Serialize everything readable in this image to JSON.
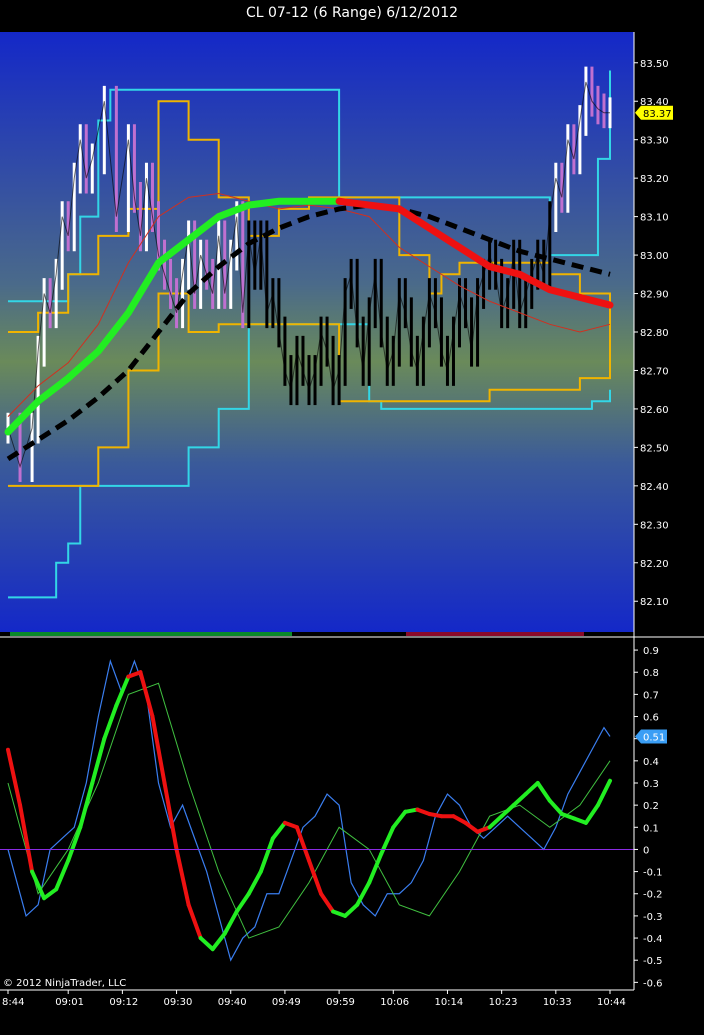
{
  "window": {
    "title": "CL 07-12 (6 Range)  6/12/2012",
    "copyright": "© 2012 NinjaTrader, LLC"
  },
  "colors": {
    "background": "#000000",
    "price_panel_top": "#1428c8",
    "price_panel_mid": "#5a7a5a",
    "price_panel_bottom": "#1428c8",
    "up_bars": "#ffffff",
    "down_bars": "#000000",
    "transition_bars": "#c070d0",
    "channel_outer": "#33d6e6",
    "channel_inner": "#f0b400",
    "dotted_channel": "#d8d8d8",
    "slow_ma_up": "#22ee22",
    "slow_ma_down": "#ee1111",
    "dashed_ma": "#000000",
    "oscillator_fast": "#3a7ef0",
    "zero_line": "#8a2be2",
    "last_price_badge": "#ffff00",
    "last_osc_badge": "#3a9ef5",
    "trend_strip_up": "#0a8a2a",
    "trend_strip_down": "#8a0a2a"
  },
  "chart_data": [
    {
      "type": "line",
      "title": "CL 07-12 (6 Range)  6/12/2012",
      "panel": "price",
      "y_ticks": [
        "83.50",
        "83.40",
        "83.30",
        "83.20",
        "83.10",
        "83.00",
        "82.90",
        "82.80",
        "82.70",
        "82.60",
        "82.50",
        "82.40",
        "82.30",
        "82.20",
        "82.10"
      ],
      "ylim": [
        82.02,
        83.58
      ],
      "last_value_label": "83.37",
      "last_value": 83.37,
      "grid": false,
      "x_index_range": [
        0,
        100
      ],
      "series": [
        {
          "role": "price-close",
          "x": [
            0,
            2,
            4,
            5,
            6,
            7,
            8,
            9,
            10,
            11,
            12,
            13,
            14,
            16,
            18,
            20,
            21,
            22,
            23,
            24,
            25,
            26,
            27,
            28,
            29,
            30,
            31,
            32,
            33,
            34,
            35,
            36,
            37,
            38,
            39,
            40,
            41,
            42,
            43,
            44,
            45,
            46,
            47,
            48,
            49,
            50,
            51,
            52,
            53,
            54,
            55,
            56,
            57,
            58,
            59,
            60,
            61,
            62,
            63,
            64,
            65,
            66,
            67,
            68,
            69,
            70,
            71,
            72,
            73,
            74,
            75,
            76,
            77,
            78,
            79,
            80,
            81,
            82,
            83,
            84,
            85,
            86,
            87,
            88,
            89,
            90,
            91,
            92,
            93,
            94,
            95,
            96,
            97,
            98,
            99,
            100
          ],
          "values": [
            82.55,
            82.45,
            82.55,
            82.75,
            82.9,
            82.85,
            82.95,
            83.1,
            83.05,
            83.2,
            83.3,
            83.2,
            83.25,
            83.4,
            83.1,
            83.3,
            83.15,
            83.05,
            83.2,
            83.1,
            83.0,
            82.95,
            82.9,
            82.85,
            82.95,
            83.05,
            82.9,
            83.0,
            82.95,
            82.9,
            83.05,
            82.9,
            83.0,
            83.1,
            82.85,
            83.05,
            82.95,
            83.05,
            82.85,
            82.9,
            82.8,
            82.7,
            82.65,
            82.75,
            82.7,
            82.65,
            82.7,
            82.8,
            82.75,
            82.65,
            82.7,
            82.9,
            82.95,
            82.8,
            82.7,
            82.85,
            82.95,
            82.8,
            82.7,
            82.75,
            82.9,
            82.85,
            82.75,
            82.7,
            82.8,
            82.9,
            82.85,
            82.75,
            82.7,
            82.8,
            82.9,
            82.85,
            82.75,
            82.9,
            82.95,
            83.0,
            82.95,
            82.85,
            82.9,
            83.0,
            82.85,
            82.9,
            82.95,
            83.0,
            82.95,
            83.1,
            83.2,
            83.15,
            83.3,
            83.25,
            83.35,
            83.45,
            83.4,
            83.38,
            83.37,
            83.37
          ]
        },
        {
          "role": "channel-outer-upper",
          "x": [
            0,
            5,
            8,
            10,
            12,
            15,
            17,
            20,
            25,
            30,
            35,
            40,
            45,
            50,
            55,
            58,
            60,
            63,
            65,
            70,
            75,
            80,
            85,
            88,
            90,
            92,
            95,
            96,
            98,
            100
          ],
          "values": [
            82.88,
            82.88,
            82.88,
            82.95,
            83.1,
            83.35,
            83.43,
            83.43,
            83.43,
            83.43,
            83.43,
            83.43,
            83.43,
            83.43,
            83.15,
            83.15,
            83.15,
            83.15,
            83.15,
            83.15,
            83.15,
            83.15,
            83.15,
            83.15,
            83.0,
            83.0,
            83.0,
            83.0,
            83.25,
            83.48
          ]
        },
        {
          "role": "channel-outer-lower",
          "x": [
            0,
            5,
            8,
            10,
            12,
            15,
            20,
            25,
            30,
            35,
            40,
            45,
            50,
            55,
            58,
            60,
            62,
            65,
            70,
            75,
            80,
            85,
            90,
            95,
            97,
            100
          ],
          "values": [
            82.11,
            82.11,
            82.2,
            82.25,
            82.4,
            82.4,
            82.4,
            82.4,
            82.5,
            82.6,
            82.82,
            82.82,
            82.82,
            82.82,
            82.82,
            82.62,
            82.6,
            82.6,
            82.6,
            82.6,
            82.6,
            82.6,
            82.6,
            82.6,
            82.62,
            82.65
          ]
        },
        {
          "role": "channel-inner-upper",
          "x": [
            0,
            5,
            10,
            15,
            20,
            25,
            30,
            35,
            40,
            45,
            50,
            55,
            60,
            65,
            70,
            72,
            75,
            80,
            85,
            90,
            95,
            100
          ],
          "values": [
            82.8,
            82.85,
            82.95,
            83.05,
            83.12,
            83.4,
            83.3,
            83.15,
            83.05,
            83.12,
            83.15,
            83.15,
            83.15,
            83.0,
            82.9,
            82.95,
            82.98,
            82.98,
            82.98,
            82.95,
            82.9,
            82.77
          ]
        },
        {
          "role": "channel-inner-lower",
          "x": [
            0,
            5,
            10,
            15,
            20,
            25,
            30,
            35,
            40,
            45,
            50,
            55,
            60,
            65,
            70,
            75,
            80,
            85,
            90,
            95,
            100
          ],
          "values": [
            82.4,
            82.4,
            82.4,
            82.5,
            82.7,
            82.9,
            82.8,
            82.82,
            82.82,
            82.82,
            82.82,
            82.62,
            82.62,
            82.62,
            82.62,
            82.62,
            82.65,
            82.65,
            82.65,
            82.68,
            82.77
          ]
        },
        {
          "role": "slow-ma",
          "x": [
            0,
            5,
            10,
            15,
            20,
            25,
            30,
            35,
            40,
            45,
            50,
            55,
            60,
            65,
            70,
            75,
            80,
            85,
            90,
            95,
            100
          ],
          "values": [
            82.54,
            82.62,
            82.68,
            82.75,
            82.85,
            82.98,
            83.04,
            83.1,
            83.13,
            83.14,
            83.14,
            83.14,
            83.13,
            83.12,
            83.07,
            83.02,
            82.97,
            82.95,
            82.91,
            82.89,
            82.87
          ]
        },
        {
          "role": "dashed-ma",
          "x": [
            0,
            5,
            10,
            15,
            20,
            25,
            30,
            35,
            40,
            45,
            50,
            55,
            60,
            65,
            70,
            75,
            80,
            85,
            90,
            95,
            100
          ],
          "values": [
            82.47,
            82.52,
            82.57,
            82.63,
            82.7,
            82.8,
            82.9,
            82.97,
            83.03,
            83.07,
            83.1,
            83.12,
            83.13,
            83.12,
            83.1,
            83.07,
            83.04,
            83.01,
            82.99,
            82.97,
            82.95
          ]
        },
        {
          "role": "thin-ma",
          "x": [
            0,
            5,
            10,
            15,
            20,
            25,
            30,
            35,
            40,
            45,
            50,
            55,
            60,
            65,
            70,
            75,
            80,
            85,
            90,
            95,
            100
          ],
          "values": [
            82.58,
            82.66,
            82.72,
            82.82,
            82.98,
            83.1,
            83.15,
            83.16,
            83.14,
            83.12,
            83.13,
            83.12,
            83.1,
            83.02,
            82.97,
            82.92,
            82.88,
            82.85,
            82.82,
            82.8,
            82.82
          ]
        }
      ]
    },
    {
      "type": "line",
      "panel": "oscillator",
      "y_ticks": [
        "0.9",
        "0.8",
        "0.7",
        "0.6",
        "0.5",
        "0.4",
        "0.3",
        "0.2",
        "0.1",
        "0",
        "-0.1",
        "-0.2",
        "-0.3",
        "-0.4",
        "-0.5",
        "-0.6"
      ],
      "ylim": [
        -0.63,
        0.95
      ],
      "zero_line": 0,
      "last_value_label": "0.51",
      "last_value": 0.51,
      "x_tick_labels": [
        "8:44",
        "09:01",
        "09:12",
        "09:30",
        "09:40",
        "09:49",
        "09:59",
        "10:06",
        "10:14",
        "10:23",
        "10:33",
        "10:44"
      ],
      "x_tick_index": [
        0,
        10,
        19,
        28,
        37,
        46,
        55,
        64,
        73,
        82,
        91,
        100
      ],
      "grid": false,
      "series": [
        {
          "role": "fast-oscillator",
          "x": [
            0,
            3,
            5,
            7,
            9,
            11,
            13,
            15,
            17,
            19,
            21,
            23,
            25,
            27,
            29,
            31,
            33,
            35,
            37,
            39,
            41,
            43,
            45,
            47,
            49,
            51,
            53,
            55,
            57,
            59,
            61,
            63,
            65,
            67,
            69,
            71,
            73,
            75,
            77,
            79,
            81,
            83,
            85,
            87,
            89,
            91,
            93,
            95,
            97,
            99,
            100
          ],
          "values": [
            0.0,
            -0.3,
            -0.25,
            0.0,
            0.05,
            0.1,
            0.3,
            0.6,
            0.85,
            0.7,
            0.85,
            0.7,
            0.3,
            0.1,
            0.2,
            0.05,
            -0.1,
            -0.3,
            -0.5,
            -0.4,
            -0.35,
            -0.2,
            -0.2,
            -0.05,
            0.1,
            0.15,
            0.25,
            0.2,
            -0.15,
            -0.25,
            -0.3,
            -0.2,
            -0.2,
            -0.15,
            -0.05,
            0.15,
            0.25,
            0.2,
            0.1,
            0.05,
            0.1,
            0.15,
            0.1,
            0.05,
            0.0,
            0.1,
            0.25,
            0.35,
            0.45,
            0.55,
            0.51
          ]
        },
        {
          "role": "signal-thin",
          "x": [
            0,
            5,
            10,
            15,
            20,
            25,
            30,
            35,
            40,
            45,
            50,
            55,
            60,
            65,
            70,
            75,
            80,
            85,
            90,
            95,
            100
          ],
          "values": [
            0.3,
            -0.2,
            0.0,
            0.3,
            0.7,
            0.75,
            0.3,
            -0.1,
            -0.4,
            -0.35,
            -0.15,
            0.1,
            0.0,
            -0.25,
            -0.3,
            -0.1,
            0.15,
            0.2,
            0.1,
            0.2,
            0.4
          ]
        },
        {
          "role": "signal-thick",
          "x": [
            0,
            2,
            4,
            6,
            8,
            10,
            12,
            14,
            16,
            18,
            20,
            22,
            24,
            26,
            28,
            30,
            32,
            34,
            36,
            38,
            40,
            42,
            44,
            46,
            48,
            50,
            52,
            54,
            56,
            58,
            60,
            62,
            64,
            66,
            68,
            70,
            72,
            74,
            76,
            78,
            80,
            82,
            84,
            86,
            88,
            90,
            92,
            94,
            96,
            98,
            100
          ],
          "values": [
            0.45,
            0.2,
            -0.1,
            -0.22,
            -0.18,
            -0.05,
            0.1,
            0.3,
            0.5,
            0.65,
            0.78,
            0.8,
            0.6,
            0.3,
            0.0,
            -0.25,
            -0.4,
            -0.45,
            -0.38,
            -0.28,
            -0.2,
            -0.1,
            0.05,
            0.12,
            0.1,
            -0.05,
            -0.2,
            -0.28,
            -0.3,
            -0.25,
            -0.15,
            -0.02,
            0.1,
            0.17,
            0.18,
            0.16,
            0.15,
            0.15,
            0.12,
            0.08,
            0.1,
            0.15,
            0.2,
            0.25,
            0.3,
            0.22,
            0.16,
            0.14,
            0.12,
            0.2,
            0.31
          ],
          "colors_by_segment": [
            "down",
            "down",
            "up",
            "up",
            "up",
            "up",
            "up",
            "up",
            "up",
            "up",
            "down",
            "down",
            "down",
            "down",
            "down",
            "down",
            "up",
            "up",
            "up",
            "up",
            "up",
            "up",
            "up",
            "down",
            "down",
            "down",
            "down",
            "up",
            "up",
            "up",
            "up",
            "up",
            "up",
            "up",
            "down",
            "down",
            "down",
            "down",
            "down",
            "down",
            "up",
            "up",
            "up",
            "up",
            "up",
            "up",
            "up",
            "up",
            "up",
            "up"
          ]
        }
      ]
    }
  ]
}
